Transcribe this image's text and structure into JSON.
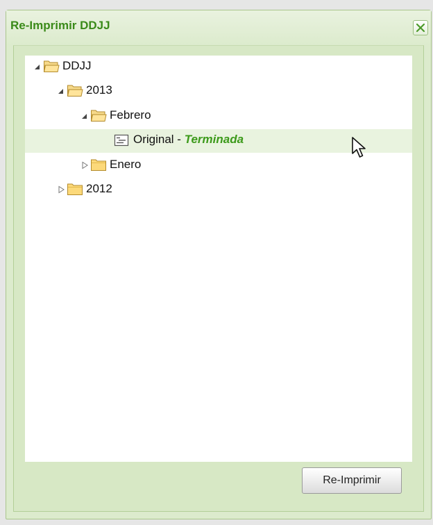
{
  "window": {
    "title": "Re-Imprimir DDJJ"
  },
  "tree": {
    "root": {
      "label": "DDJJ",
      "expanded": true
    },
    "year_2013": {
      "label": "2013",
      "expanded": true
    },
    "febrero": {
      "label": "Febrero",
      "expanded": true
    },
    "original": {
      "label": "Original - ",
      "status": "Terminada",
      "selected": true
    },
    "enero": {
      "label": "Enero",
      "expanded": false
    },
    "year_2012": {
      "label": "2012",
      "expanded": false
    }
  },
  "actions": {
    "reprint_label": "Re-Imprimir"
  },
  "colors": {
    "title": "#3a8a19",
    "status": "#3c9a1a",
    "panel": "#dcebcd",
    "selected_row": "#e9f3df"
  }
}
